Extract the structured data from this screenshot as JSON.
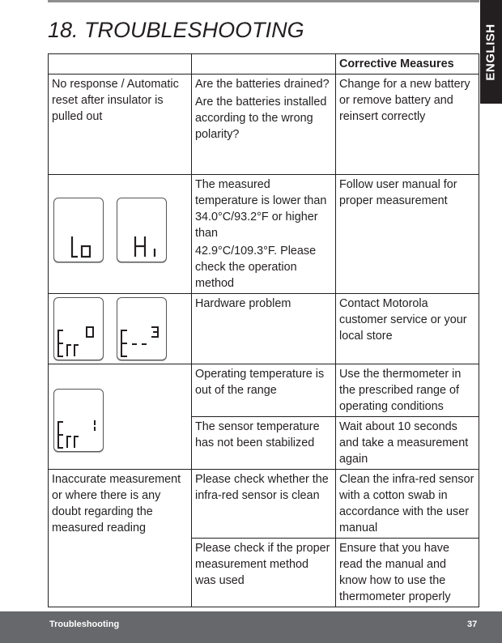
{
  "sidebar_tab": {
    "label": "ENGLISH"
  },
  "title": "18. TROUBLESHOOTING",
  "table": {
    "header": [
      "",
      "",
      "Corrective Measures"
    ],
    "rows": [
      {
        "problem": "No response / Automatic reset after insulator is pulled out",
        "causes": [
          {
            "paras": [
              "Are the batteries drained?",
              "Are the batteries installed according to the wrong polarity?"
            ],
            "measure": "Change for a new battery or remove battery and reinsert correctly"
          }
        ]
      },
      {
        "display_icons": [
          "lcd-lo",
          "lcd-hi"
        ],
        "causes": [
          {
            "paras": [
              "The measured temperature is lower than 34.0°C/93.2°F or higher than",
              "42.9°C/109.3°F. Please check the operation method"
            ],
            "measure": "Follow user manual for proper measurement"
          }
        ]
      },
      {
        "display_icons": [
          "lcd-err0",
          "lcd-e--3"
        ],
        "causes": [
          {
            "paras": [
              "Hardware problem"
            ],
            "measure": "Contact Motorola customer service or your local store"
          }
        ]
      },
      {
        "display_icons": [
          "lcd-err1"
        ],
        "causes": [
          {
            "paras": [
              "Operating temperature is out of the range"
            ],
            "measure": "Use the thermometer in the prescribed range of operating conditions"
          },
          {
            "paras": [
              "The sensor temperature has not been stabilized"
            ],
            "measure": "Wait about 10 seconds and take a measurement again"
          }
        ]
      },
      {
        "problem": "Inaccurate measurement or where there is any doubt regarding the measured reading",
        "causes": [
          {
            "paras": [
              "Please check whether the infra-red sensor is clean"
            ],
            "measure": "Clean the infra-red sensor with a cotton swab in accordance with the user manual"
          },
          {
            "paras": [
              "Please check if the proper measurement method was used"
            ],
            "measure": "Ensure that you have read the manual and know how to use the thermometer properly"
          }
        ]
      }
    ]
  },
  "footer": {
    "section": "Troubleshooting",
    "page": "37"
  },
  "colors": {
    "footer_bg": "#67686c",
    "tab_bg": "#231f20",
    "text": "#231f20"
  }
}
